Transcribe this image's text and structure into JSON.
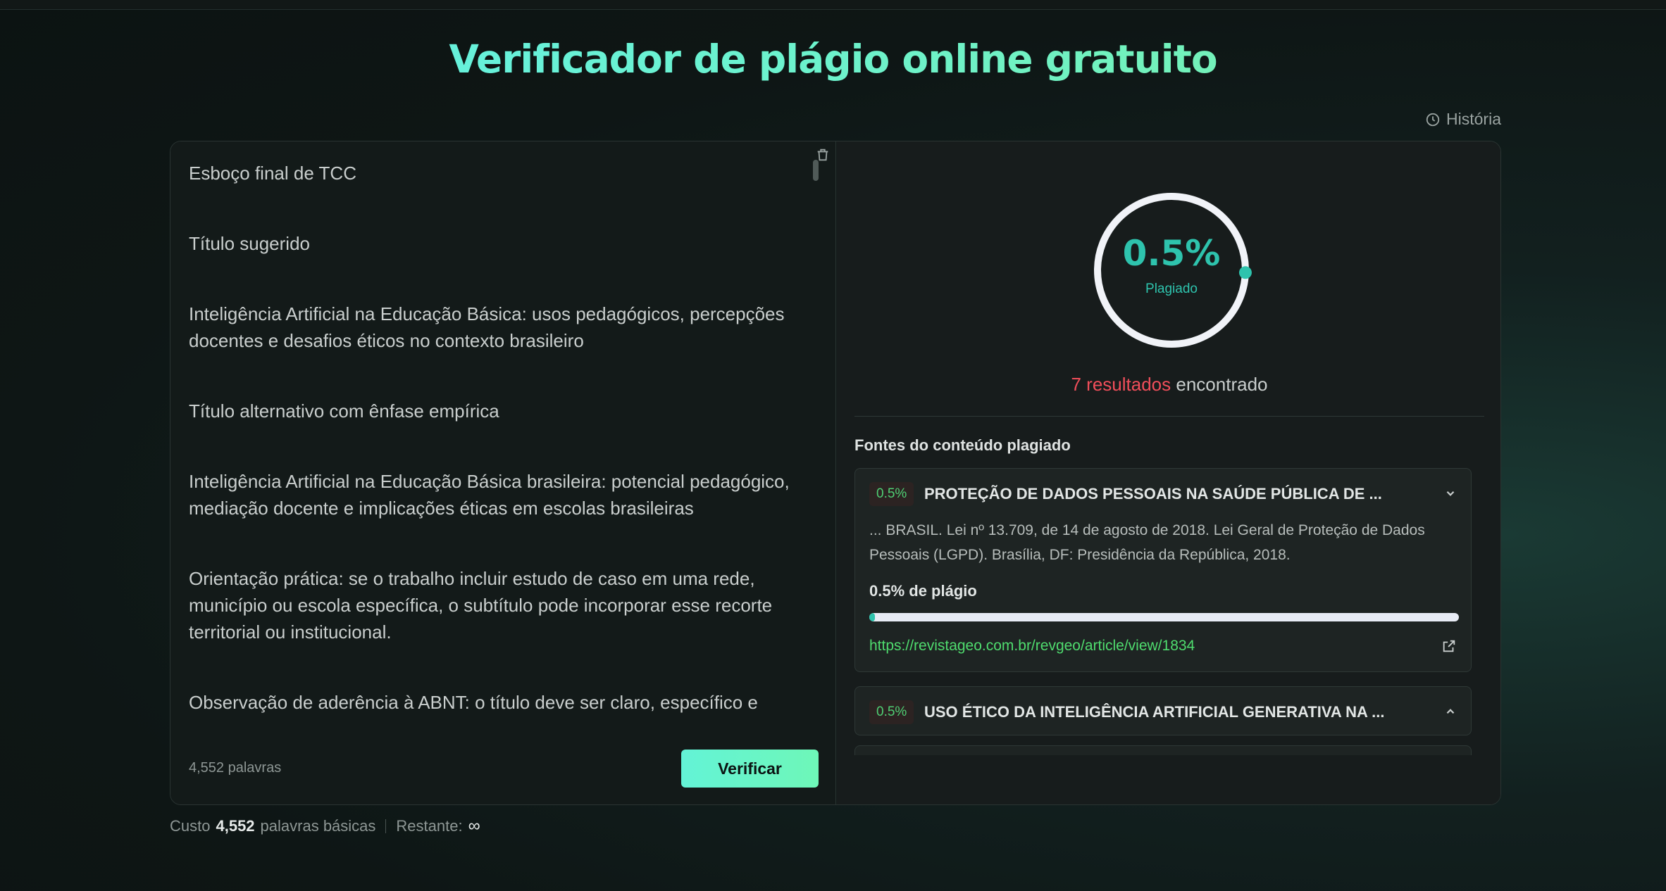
{
  "header": {
    "title": "Verificador de plágio online gratuito",
    "history_label": "História"
  },
  "editor": {
    "paragraphs": [
      "Esboço final de TCC",
      "Título sugerido",
      "Inteligência Artificial na Educação Básica: usos pedagógicos, percepções docentes e desafios éticos no contexto brasileiro",
      "Título alternativo com ênfase empírica",
      "Inteligência Artificial na Educação Básica brasileira: potencial pedagógico, mediação docente e implicações éticas em escolas brasileiras",
      "Orientação prática: se o trabalho incluir estudo de caso em uma rede, município ou escola específica, o subtítulo pode incorporar esse recorte territorial ou institucional.",
      "Observação de aderência à ABNT: o título deve ser claro, específico e"
    ],
    "word_count": "4,552 palavras",
    "verify_label": "Verificar"
  },
  "result": {
    "score": "0.5%",
    "score_fraction": 0.005,
    "score_label": "Plagiado",
    "results_count": "7 resultados",
    "results_suffix": "encontrado",
    "sources_title": "Fontes do conteúdo plagiado",
    "sources": [
      {
        "badge": "0.5%",
        "title": "PROTEÇÃO DE DADOS PESSOAIS NA SAÚDE PÚBLICA DE ...",
        "excerpt": "... BRASIL. Lei nº 13.709, de 14 de agosto de 2018. Lei Geral de Proteção de Dados Pessoais (LGPD). Brasília, DF: Presidência da República, 2018.",
        "pct_label": "0.5% de plágio",
        "progress": 0.005,
        "url": "https://revistageo.com.br/revgeo/article/view/1834"
      },
      {
        "badge": "0.5%",
        "title": "USO ÉTICO DA INTELIGÊNCIA ARTIFICIAL GENERATIVA NA ..."
      }
    ]
  },
  "footer": {
    "cost_prefix": "Custo",
    "cost_value": "4,552",
    "cost_suffix": "palavras básicas",
    "remaining_label": "Restante:",
    "remaining_value": "∞"
  },
  "colors": {
    "accent": "#2ec3ad",
    "danger": "#f04e5a",
    "link": "#4fdc6e"
  }
}
